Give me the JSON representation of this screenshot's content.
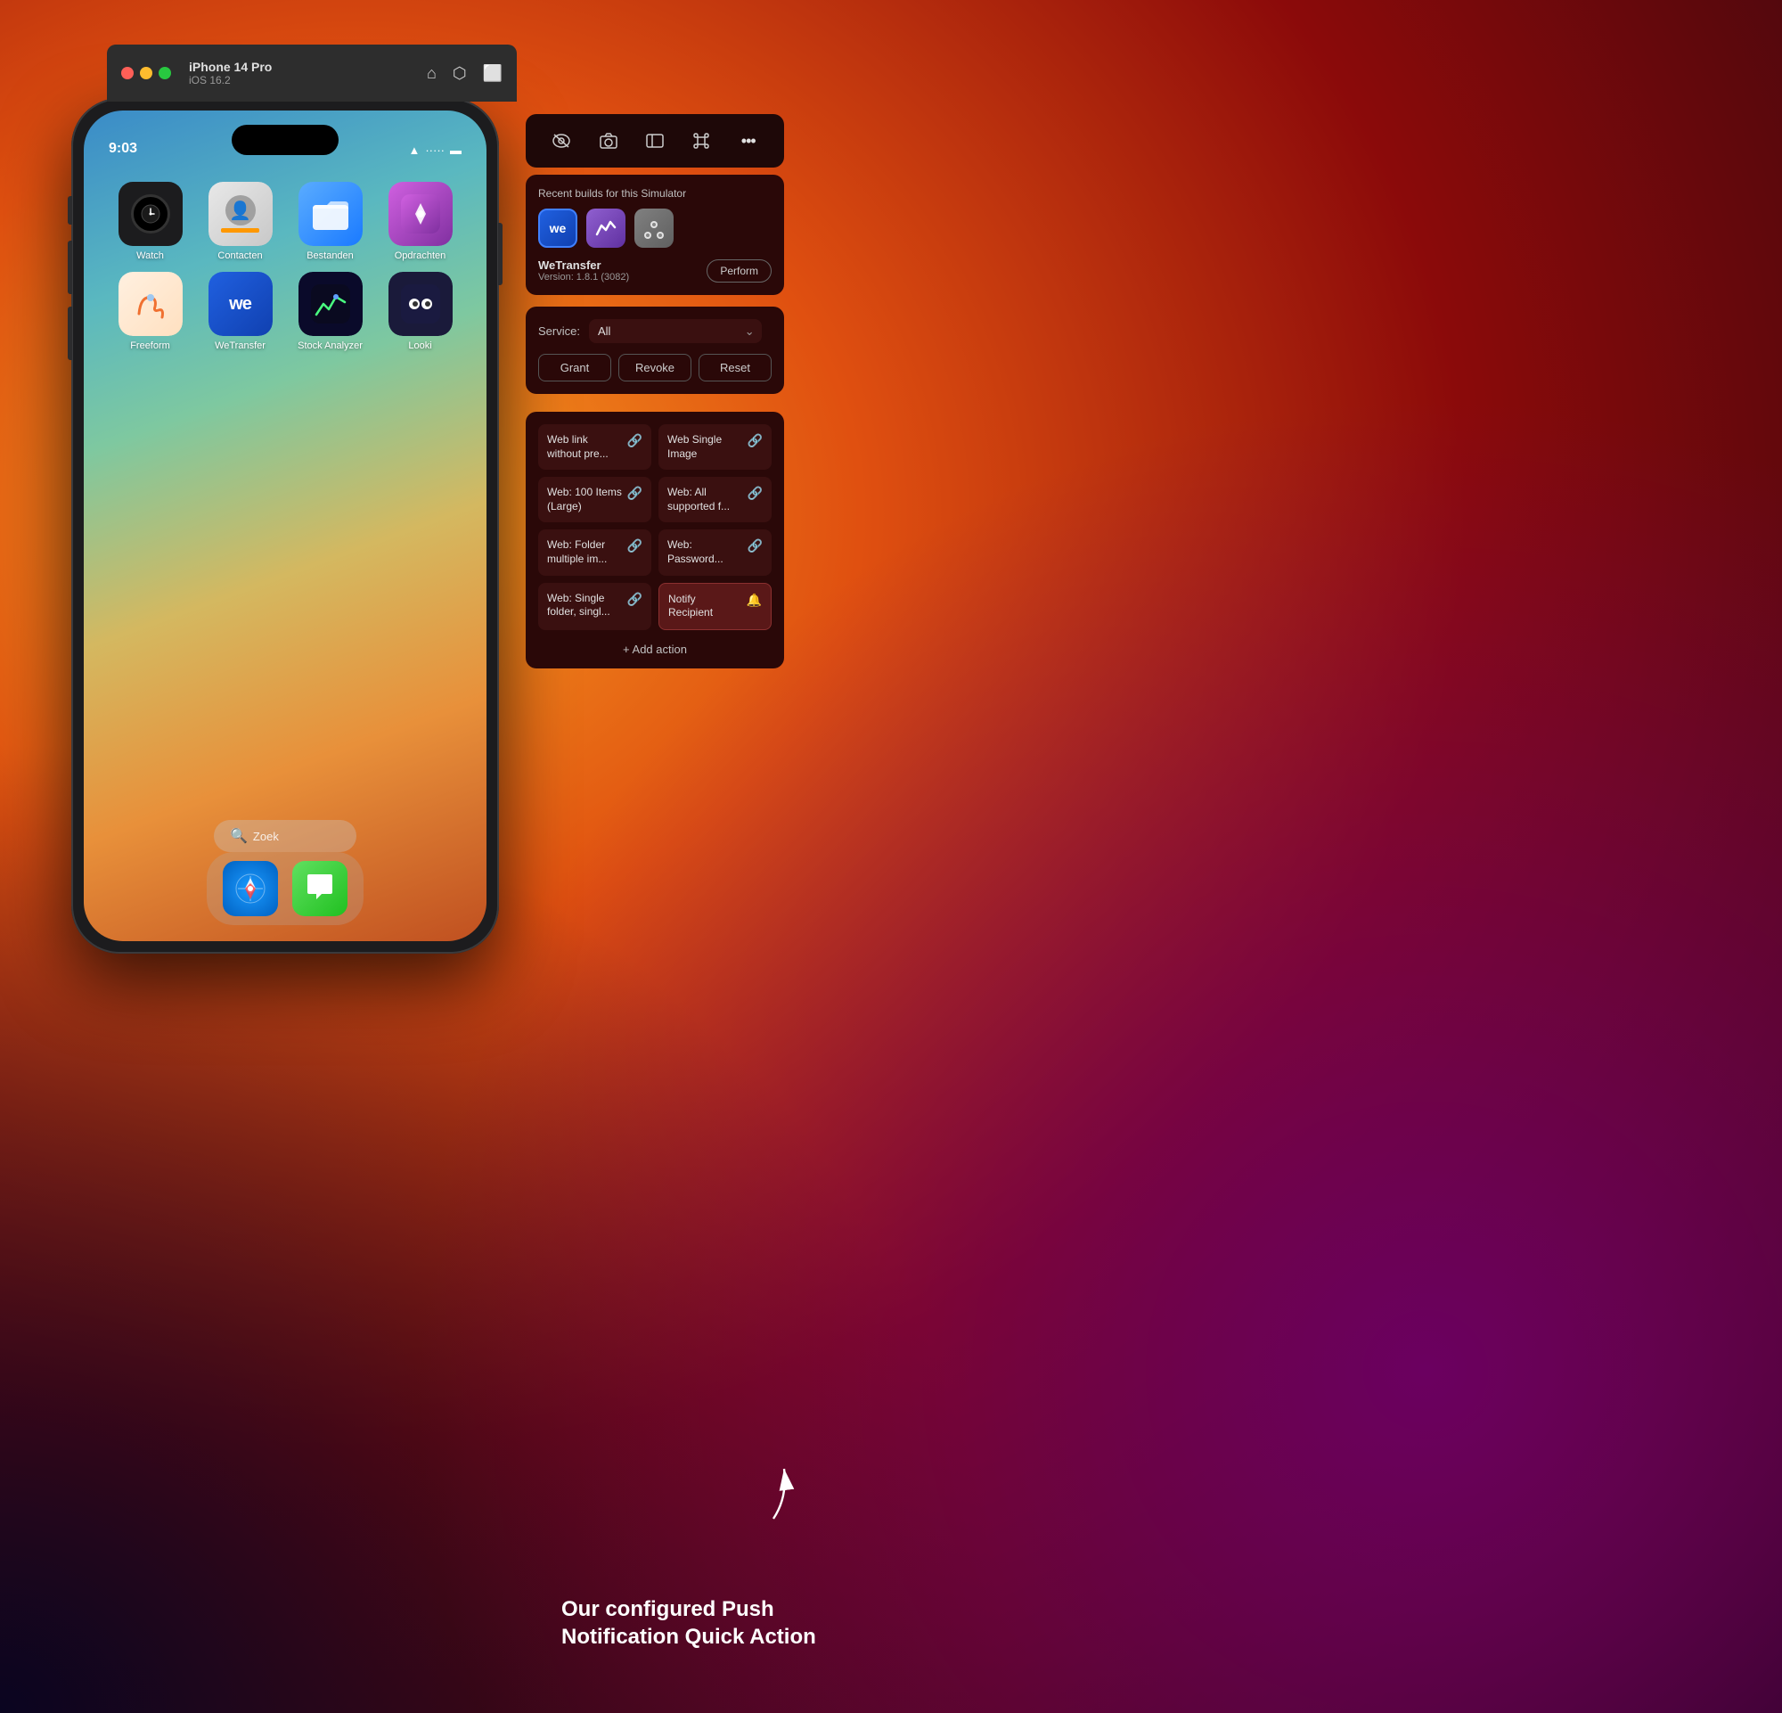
{
  "window": {
    "title": "iPhone 14 Pro",
    "subtitle": "iOS 16.2",
    "traffic_lights": {
      "red": "close",
      "yellow": "minimize",
      "green": "maximize"
    },
    "toolbar": {
      "home_icon": "⌂",
      "screenshot_icon": "📷",
      "rotate_icon": "⬜"
    }
  },
  "iphone": {
    "status_bar": {
      "time": "9:03",
      "wifi": "wifi",
      "battery": "battery"
    },
    "apps_row1": [
      {
        "id": "watch",
        "label": "Watch"
      },
      {
        "id": "contacts",
        "label": "Contacten"
      },
      {
        "id": "files",
        "label": "Bestanden"
      },
      {
        "id": "shortcuts",
        "label": "Opdrachten"
      }
    ],
    "apps_row2": [
      {
        "id": "freeform",
        "label": "Freeform"
      },
      {
        "id": "wetransfer",
        "label": "WeTransfer"
      },
      {
        "id": "stockanalyzer",
        "label": "Stock Analyzer"
      },
      {
        "id": "looki",
        "label": "Looki"
      }
    ],
    "search_bar": {
      "icon": "🔍",
      "placeholder": "Zoek"
    },
    "dock": {
      "apps": [
        "Safari",
        "Messages"
      ]
    }
  },
  "simulator_toolbar": {
    "buttons": [
      "eye-off",
      "camera",
      "sidebar",
      "command",
      "more"
    ]
  },
  "recent_builds_panel": {
    "title": "Recent builds for this Simulator",
    "apps": [
      {
        "id": "wetransfer",
        "label": "WeTransfer"
      },
      {
        "id": "purple",
        "label": "Purple app"
      },
      {
        "id": "gray",
        "label": "Gray app"
      }
    ],
    "selected_app": "WeTransfer",
    "version": "Version: 1.8.1 (3082)",
    "perform_button": "Perform"
  },
  "service_panel": {
    "service_label": "Service:",
    "service_value": "All",
    "buttons": {
      "grant": "Grant",
      "revoke": "Revoke",
      "reset": "Reset"
    }
  },
  "actions_panel": {
    "actions": [
      {
        "id": "web-link",
        "label": "Web link without pre...",
        "icon": "link"
      },
      {
        "id": "web-single-image",
        "label": "Web Single Image",
        "icon": "link"
      },
      {
        "id": "web-100-items",
        "label": "Web: 100 Items (Large)",
        "icon": "link"
      },
      {
        "id": "web-all-supported",
        "label": "Web: All supported f...",
        "icon": "link"
      },
      {
        "id": "web-folder-multiple",
        "label": "Web: Folder multiple im...",
        "icon": "link"
      },
      {
        "id": "web-password",
        "label": "Web: Password...",
        "icon": "link"
      },
      {
        "id": "web-single-folder",
        "label": "Web: Single folder, singl...",
        "icon": "link"
      },
      {
        "id": "notify-recipient",
        "label": "Notify Recipient",
        "icon": "bell",
        "highlighted": true
      }
    ],
    "add_action": "+ Add action"
  },
  "annotation": {
    "text": "Our configured Push Notification Quick Action"
  }
}
